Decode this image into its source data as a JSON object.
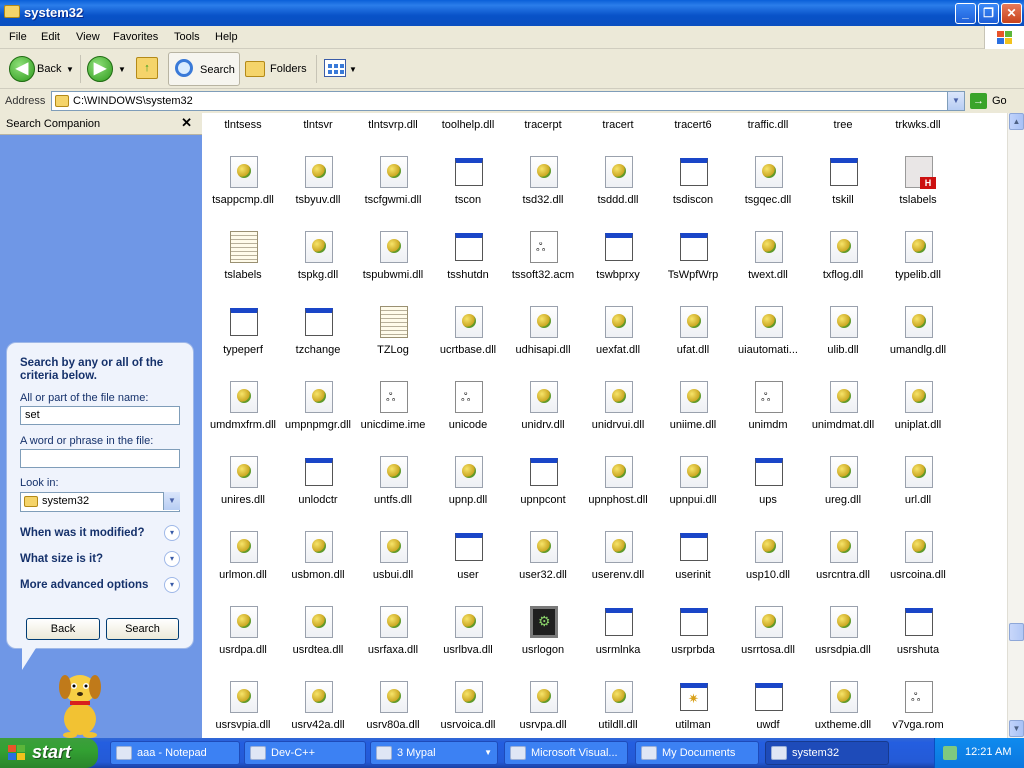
{
  "window": {
    "title": "system32"
  },
  "menu": [
    "File",
    "Edit",
    "View",
    "Favorites",
    "Tools",
    "Help"
  ],
  "toolbar": {
    "back_label": "Back",
    "search_label": "Search",
    "folders_label": "Folders"
  },
  "address": {
    "label": "Address",
    "value": "C:\\WINDOWS\\system32",
    "go_label": "Go"
  },
  "search_companion": {
    "header": "Search Companion",
    "heading": "Search by any or all of the criteria below.",
    "filename_label": "All or part of the file name:",
    "filename_value": "set",
    "phrase_label": "A word or phrase in the file:",
    "phrase_value": "",
    "lookin_label": "Look in:",
    "lookin_value": "system32",
    "option_modified": "When was it modified?",
    "option_size": "What size is it?",
    "option_advanced": "More advanced options",
    "back_button": "Back",
    "search_button": "Search"
  },
  "files": [
    {
      "name": "tlntsess",
      "icon": "exe"
    },
    {
      "name": "tlntsvr",
      "icon": "exe"
    },
    {
      "name": "tlntsvrp.dll",
      "icon": "dll"
    },
    {
      "name": "toolhelp.dll",
      "icon": "dll"
    },
    {
      "name": "tracerpt",
      "icon": "exe"
    },
    {
      "name": "tracert",
      "icon": "exe"
    },
    {
      "name": "tracert6",
      "icon": "exe"
    },
    {
      "name": "traffic.dll",
      "icon": "dll"
    },
    {
      "name": "tree",
      "icon": "exe"
    },
    {
      "name": "trkwks.dll",
      "icon": "dll"
    },
    {
      "name": "tsappcmp.dll",
      "icon": "dll"
    },
    {
      "name": "tsbyuv.dll",
      "icon": "dll"
    },
    {
      "name": "tscfgwmi.dll",
      "icon": "dll"
    },
    {
      "name": "tscon",
      "icon": "exe"
    },
    {
      "name": "tsd32.dll",
      "icon": "dll"
    },
    {
      "name": "tsddd.dll",
      "icon": "dll"
    },
    {
      "name": "tsdiscon",
      "icon": "exe"
    },
    {
      "name": "tsgqec.dll",
      "icon": "dll"
    },
    {
      "name": "tskill",
      "icon": "exe"
    },
    {
      "name": "tslabels",
      "icon": "red"
    },
    {
      "name": "tslabels",
      "icon": "txt"
    },
    {
      "name": "tspkg.dll",
      "icon": "dll"
    },
    {
      "name": "tspubwmi.dll",
      "icon": "dll"
    },
    {
      "name": "tsshutdn",
      "icon": "exe"
    },
    {
      "name": "tssoft32.acm",
      "icon": "sys"
    },
    {
      "name": "tswbprxy",
      "icon": "exe"
    },
    {
      "name": "TsWpfWrp",
      "icon": "exe"
    },
    {
      "name": "twext.dll",
      "icon": "dll"
    },
    {
      "name": "txflog.dll",
      "icon": "dll"
    },
    {
      "name": "typelib.dll",
      "icon": "dll"
    },
    {
      "name": "typeperf",
      "icon": "exe"
    },
    {
      "name": "tzchange",
      "icon": "exe"
    },
    {
      "name": "TZLog",
      "icon": "txt"
    },
    {
      "name": "ucrtbase.dll",
      "icon": "dll"
    },
    {
      "name": "udhisapi.dll",
      "icon": "dll"
    },
    {
      "name": "uexfat.dll",
      "icon": "dll"
    },
    {
      "name": "ufat.dll",
      "icon": "dll"
    },
    {
      "name": "uiautomati...",
      "icon": "dll"
    },
    {
      "name": "ulib.dll",
      "icon": "dll"
    },
    {
      "name": "umandlg.dll",
      "icon": "dll"
    },
    {
      "name": "umdmxfrm.dll",
      "icon": "dll"
    },
    {
      "name": "umpnpmgr.dll",
      "icon": "dll"
    },
    {
      "name": "unicdime.ime",
      "icon": "sys"
    },
    {
      "name": "unicode",
      "icon": "sys"
    },
    {
      "name": "unidrv.dll",
      "icon": "dll"
    },
    {
      "name": "unidrvui.dll",
      "icon": "dll"
    },
    {
      "name": "uniime.dll",
      "icon": "dll"
    },
    {
      "name": "unimdm",
      "icon": "sys"
    },
    {
      "name": "unimdmat.dll",
      "icon": "dll"
    },
    {
      "name": "uniplat.dll",
      "icon": "dll"
    },
    {
      "name": "unires.dll",
      "icon": "dll"
    },
    {
      "name": "unlodctr",
      "icon": "exe"
    },
    {
      "name": "untfs.dll",
      "icon": "dll"
    },
    {
      "name": "upnp.dll",
      "icon": "dll"
    },
    {
      "name": "upnpcont",
      "icon": "exe"
    },
    {
      "name": "upnphost.dll",
      "icon": "dll"
    },
    {
      "name": "upnpui.dll",
      "icon": "dll"
    },
    {
      "name": "ups",
      "icon": "exe"
    },
    {
      "name": "ureg.dll",
      "icon": "dll"
    },
    {
      "name": "url.dll",
      "icon": "dll"
    },
    {
      "name": "urlmon.dll",
      "icon": "dll"
    },
    {
      "name": "usbmon.dll",
      "icon": "dll"
    },
    {
      "name": "usbui.dll",
      "icon": "dll"
    },
    {
      "name": "user",
      "icon": "exe"
    },
    {
      "name": "user32.dll",
      "icon": "dll"
    },
    {
      "name": "userenv.dll",
      "icon": "dll"
    },
    {
      "name": "userinit",
      "icon": "exe"
    },
    {
      "name": "usp10.dll",
      "icon": "dll"
    },
    {
      "name": "usrcntra.dll",
      "icon": "dll"
    },
    {
      "name": "usrcoina.dll",
      "icon": "dll"
    },
    {
      "name": "usrdpa.dll",
      "icon": "dll"
    },
    {
      "name": "usrdtea.dll",
      "icon": "dll"
    },
    {
      "name": "usrfaxa.dll",
      "icon": "dll"
    },
    {
      "name": "usrlbva.dll",
      "icon": "dll"
    },
    {
      "name": "usrlogon",
      "icon": "dark"
    },
    {
      "name": "usrmlnka",
      "icon": "exe"
    },
    {
      "name": "usrprbda",
      "icon": "exe"
    },
    {
      "name": "usrrtosa.dll",
      "icon": "dll"
    },
    {
      "name": "usrsdpia.dll",
      "icon": "dll"
    },
    {
      "name": "usrshuta",
      "icon": "exe"
    },
    {
      "name": "usrsvpia.dll",
      "icon": "dll"
    },
    {
      "name": "usrv42a.dll",
      "icon": "dll"
    },
    {
      "name": "usrv80a.dll",
      "icon": "dll"
    },
    {
      "name": "usrvoica.dll",
      "icon": "dll"
    },
    {
      "name": "usrvpa.dll",
      "icon": "dll"
    },
    {
      "name": "utildll.dll",
      "icon": "dll"
    },
    {
      "name": "utilman",
      "icon": "gear"
    },
    {
      "name": "uwdf",
      "icon": "exe"
    },
    {
      "name": "uxtheme.dll",
      "icon": "dll"
    },
    {
      "name": "v7vga.rom",
      "icon": "sys"
    }
  ],
  "taskbar": {
    "start_label": "start",
    "tasks": [
      {
        "label": "aaa - Notepad"
      },
      {
        "label": "Dev-C++"
      },
      {
        "label": "3 Mypal"
      },
      {
        "label": "Microsoft Visual..."
      },
      {
        "label": "My Documents"
      },
      {
        "label": "system32"
      }
    ],
    "clock": "12:21 AM"
  }
}
